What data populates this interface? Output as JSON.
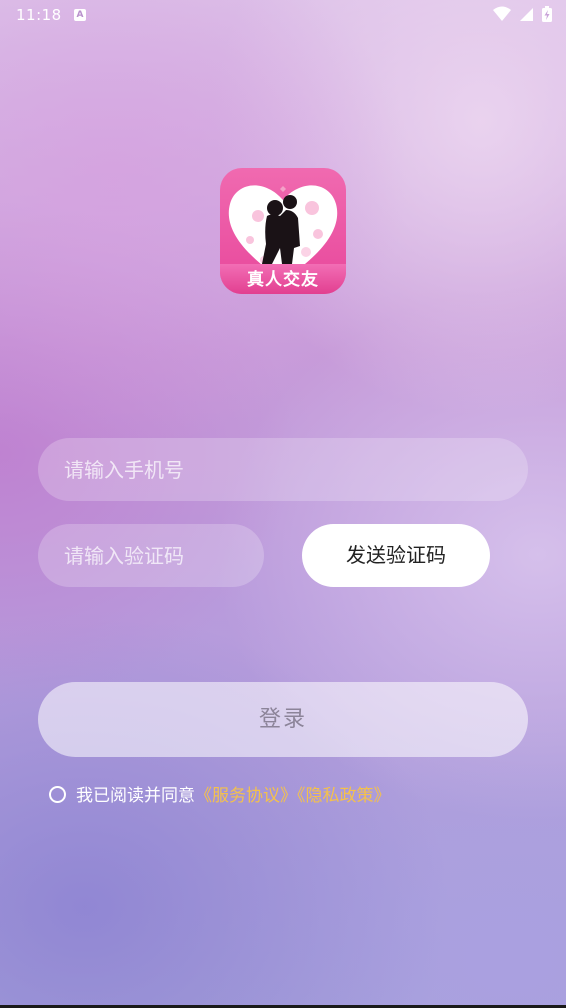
{
  "status_bar": {
    "time": "11:18",
    "notification_icon": "a-badge-icon",
    "icons": [
      "wifi-icon",
      "signal-icon",
      "battery-charging-icon"
    ]
  },
  "app": {
    "logo_label": "真人交友"
  },
  "login_form": {
    "phone_placeholder": "请输入手机号",
    "phone_value": "",
    "code_placeholder": "请输入验证码",
    "code_value": "",
    "send_code_label": "发送验证码",
    "login_label": "登录"
  },
  "agreement": {
    "checked": false,
    "text": "我已阅读并同意",
    "service_link": "《服务协议》",
    "privacy_link": "《隐私政策》"
  },
  "colors": {
    "link": "#f4c14c",
    "logo_pink": "#e8479b",
    "button_white": "#ffffff"
  }
}
